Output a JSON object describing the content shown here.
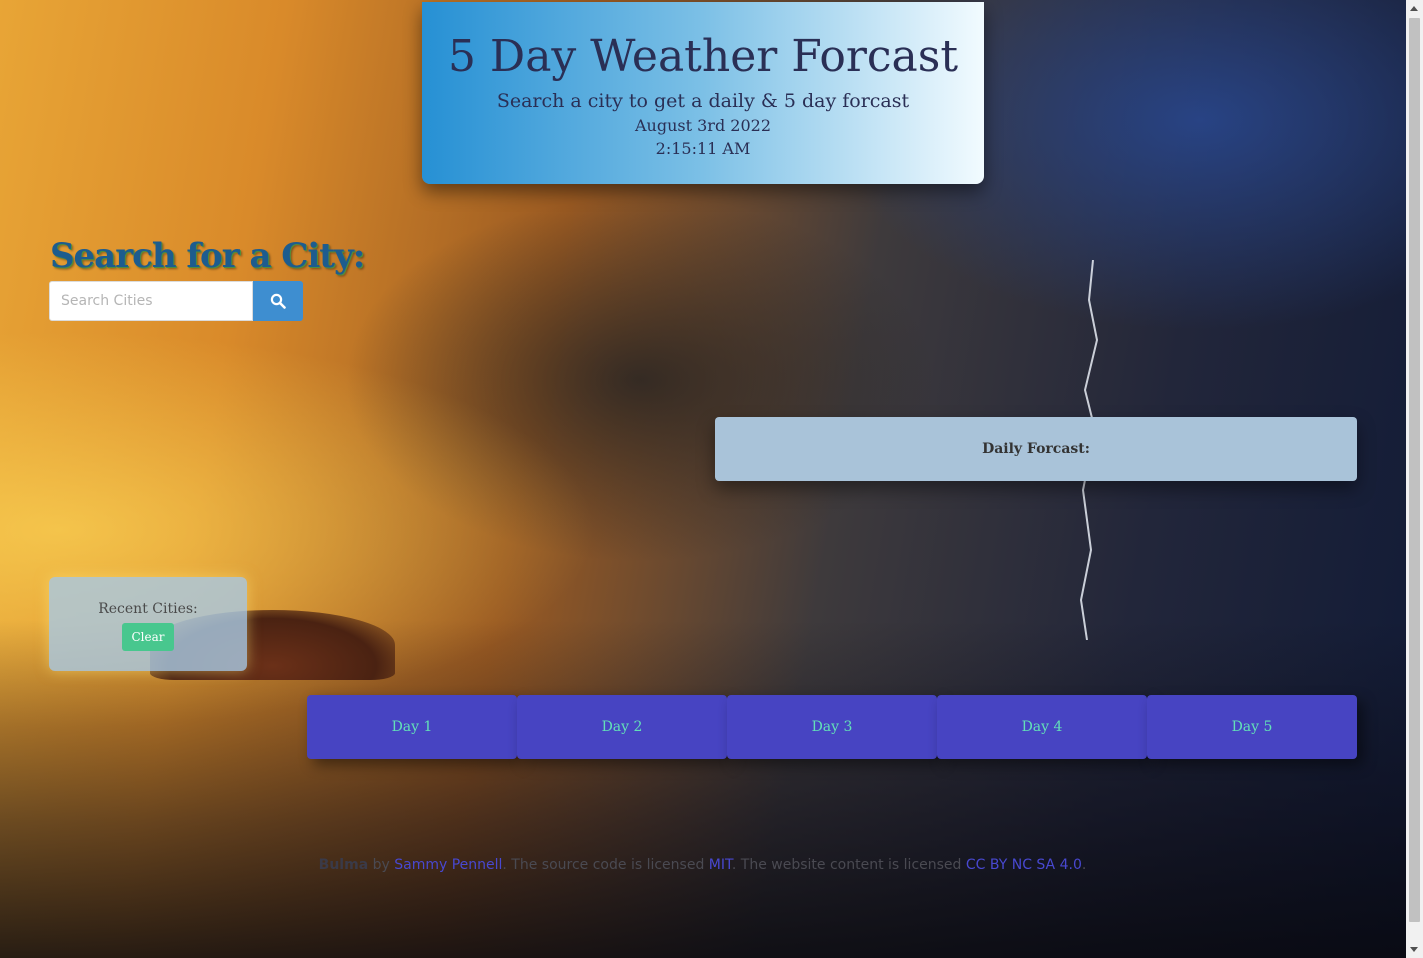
{
  "header": {
    "title": "5 Day Weather Forcast",
    "subtitle": "Search a city to get a daily & 5 day forcast",
    "date": "August 3rd 2022",
    "time": "2:15:11 AM"
  },
  "search": {
    "heading": "Search for a City:",
    "placeholder": "Search Cities",
    "button_icon": "search-icon"
  },
  "daily": {
    "label": "Daily Forcast:"
  },
  "recent": {
    "label": "Recent Cities:",
    "clear_label": "Clear"
  },
  "days": [
    {
      "label": "Day 1"
    },
    {
      "label": "Day 2"
    },
    {
      "label": "Day 3"
    },
    {
      "label": "Day 4"
    },
    {
      "label": "Day 5"
    }
  ],
  "footer": {
    "bulma": "Bulma",
    "by": " by ",
    "author": "Sammy Pennell",
    "source_text": ". The source code is licensed ",
    "mit": "MIT",
    "content_text": ". The website content is licensed ",
    "cc": "CC BY NC SA 4.0",
    "end": "."
  },
  "colors": {
    "search_button": "#3e8ed0",
    "clear_button": "#48c78e",
    "day_card": "#4744c2",
    "day_text": "#63e0b8",
    "daily_card": "#a9c3d9"
  }
}
